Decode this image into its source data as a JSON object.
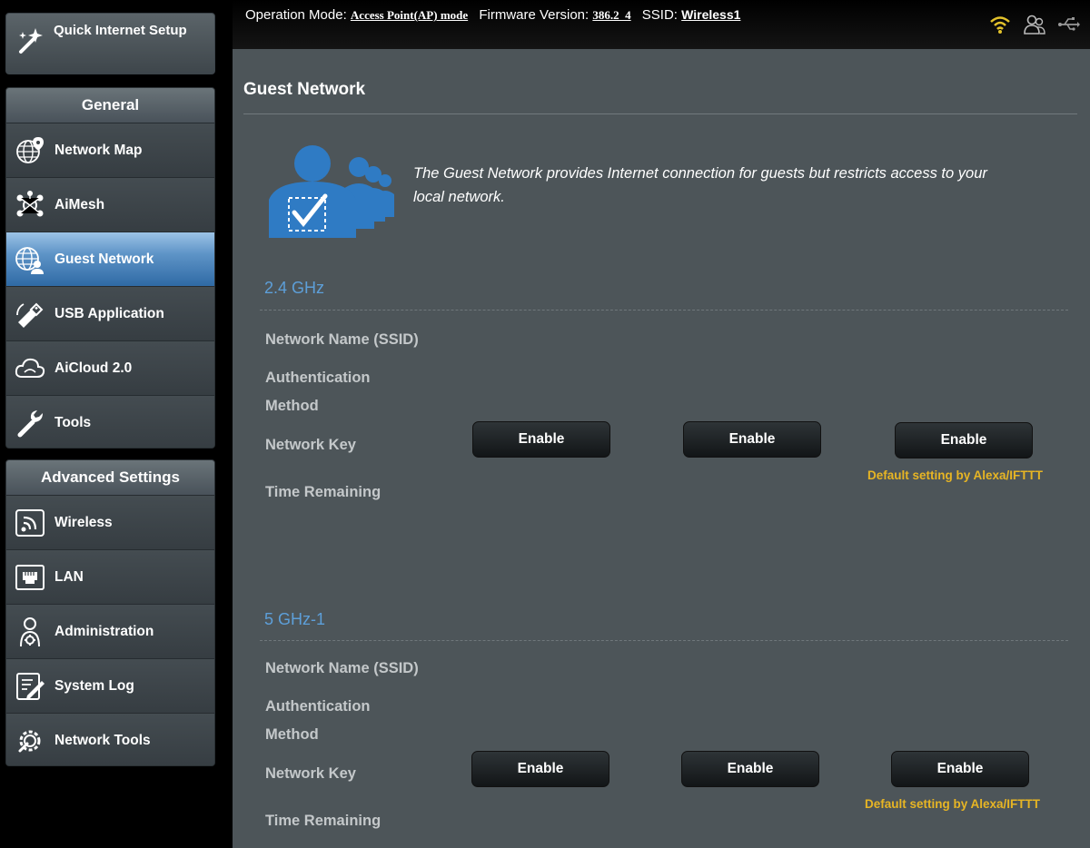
{
  "topbar": {
    "operation_mode_label": "Operation Mode:",
    "operation_mode_value": "Access Point(AP) mode",
    "firmware_label": "Firmware Version:",
    "firmware_value": "386.2_4",
    "ssid_label": "SSID:",
    "ssid_value": "Wireless1",
    "icons": [
      "wifi-icon",
      "users-icon",
      "usb-icon"
    ]
  },
  "quick_setup": {
    "label": "Quick Internet Setup"
  },
  "general": {
    "header": "General",
    "items": [
      {
        "label": "Network Map",
        "icon": "globe-pin-icon"
      },
      {
        "label": "AiMesh",
        "icon": "mesh-icon"
      },
      {
        "label": "Guest Network",
        "icon": "guest-globe-icon",
        "active": true
      },
      {
        "label": "USB Application",
        "icon": "usb-stick-icon"
      },
      {
        "label": "AiCloud 2.0",
        "icon": "cloud-icon"
      },
      {
        "label": "Tools",
        "icon": "wrench-icon"
      }
    ]
  },
  "advanced": {
    "header": "Advanced Settings",
    "items": [
      {
        "label": "Wireless",
        "icon": "wireless-icon"
      },
      {
        "label": "LAN",
        "icon": "lan-icon"
      },
      {
        "label": "Administration",
        "icon": "admin-icon"
      },
      {
        "label": "System Log",
        "icon": "log-icon"
      },
      {
        "label": "Network Tools",
        "icon": "network-tools-icon"
      }
    ]
  },
  "main": {
    "title": "Guest Network",
    "description": "The Guest Network provides Internet connection for guests but restricts access to your local network.",
    "bands": [
      {
        "title": "2.4 GHz",
        "labels": {
          "ssid": "Network Name (SSID)",
          "auth1": "Authentication",
          "auth2": "Method",
          "key": "Network Key",
          "time": "Time Remaining"
        },
        "buttons": [
          "Enable",
          "Enable",
          "Enable"
        ],
        "note": "Default setting by Alexa/IFTTT"
      },
      {
        "title": "5 GHz-1",
        "labels": {
          "ssid": "Network Name (SSID)",
          "auth1": "Authentication",
          "auth2": "Method",
          "key": "Network Key",
          "time": "Time Remaining"
        },
        "buttons": [
          "Enable",
          "Enable",
          "Enable"
        ],
        "note": "Default setting by Alexa/IFTTT"
      }
    ]
  },
  "colors": {
    "accent_blue": "#5d9fd9",
    "note_yellow": "#e7b524",
    "active_item": "#2f6aa5"
  }
}
